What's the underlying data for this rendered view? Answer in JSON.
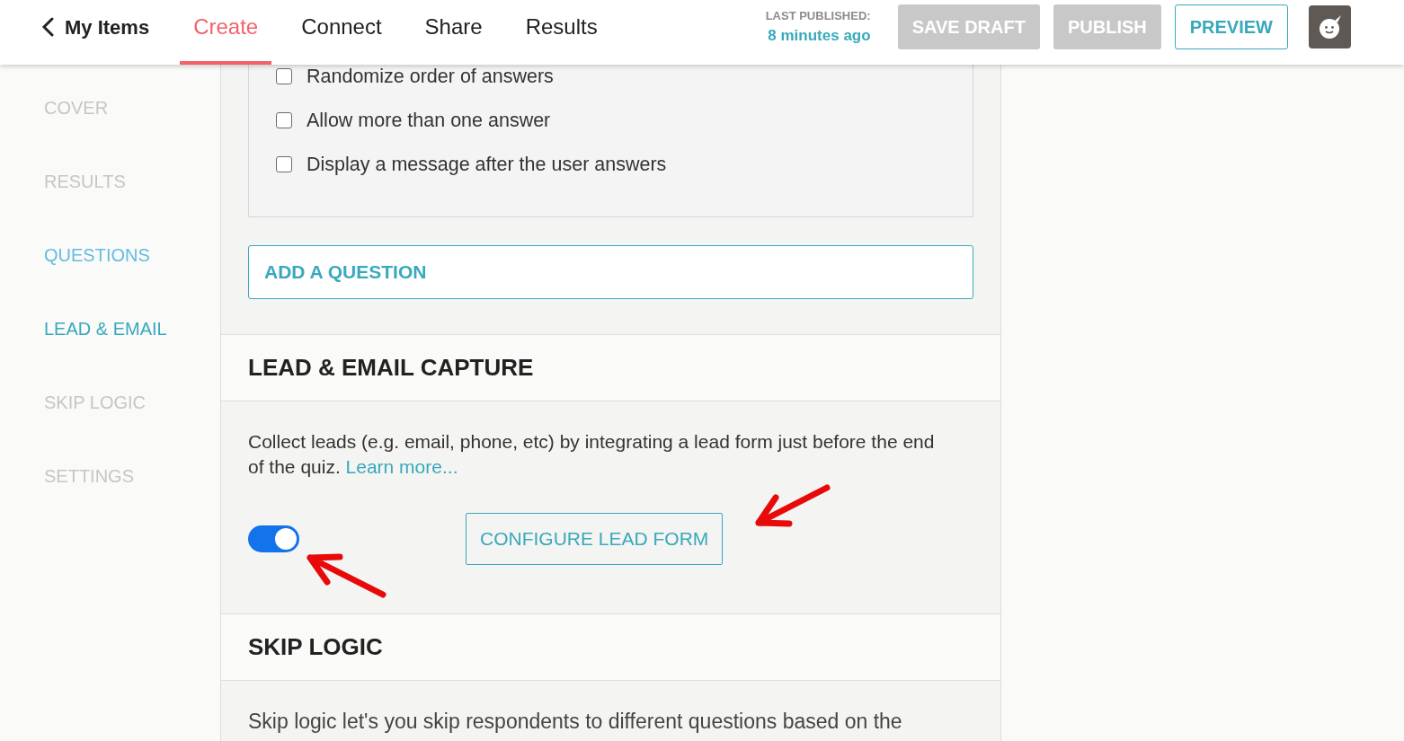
{
  "header": {
    "back_link": {
      "label": "My Items"
    },
    "tabs": [
      {
        "label": "Create",
        "selected": true
      },
      {
        "label": "Connect",
        "selected": false
      },
      {
        "label": "Share",
        "selected": false
      },
      {
        "label": "Results",
        "selected": false
      }
    ],
    "last_published": {
      "label": "LAST PUBLISHED:",
      "value": "8 minutes ago"
    },
    "buttons": [
      {
        "label": "SAVE DRAFT",
        "disabled": true
      },
      {
        "label": "PUBLISH",
        "disabled": true
      },
      {
        "label": "PREVIEW",
        "disabled": false
      }
    ]
  },
  "sidebar": {
    "items": [
      {
        "label": "COVER",
        "selected": false,
        "highlighted": false
      },
      {
        "label": "RESULTS",
        "selected": false,
        "highlighted": false
      },
      {
        "label": "QUESTIONS",
        "selected": false,
        "highlighted": true
      },
      {
        "label": "LEAD & EMAIL",
        "selected": true,
        "highlighted": false
      },
      {
        "label": "SKIP LOGIC",
        "selected": false,
        "highlighted": false
      },
      {
        "label": "SETTINGS",
        "selected": false,
        "highlighted": false
      }
    ]
  },
  "question_options": [
    {
      "label": "Randomize order of answers",
      "checked": false
    },
    {
      "label": "Allow more than one answer",
      "checked": false
    },
    {
      "label": "Display a message after the user answers",
      "checked": false
    }
  ],
  "add_question_button": {
    "label": "ADD A QUESTION"
  },
  "sections": [
    {
      "title": "LEAD & EMAIL CAPTURE",
      "description": "Collect leads (e.g. email, phone, etc) by integrating a lead form just before the end of the quiz.",
      "link": "Learn more...",
      "toggle": {
        "on": true
      },
      "button": {
        "label": "CONFIGURE LEAD FORM"
      }
    },
    {
      "title": "SKIP LOGIC",
      "description": "Skip logic let's you skip respondents to different questions based on the"
    }
  ]
}
